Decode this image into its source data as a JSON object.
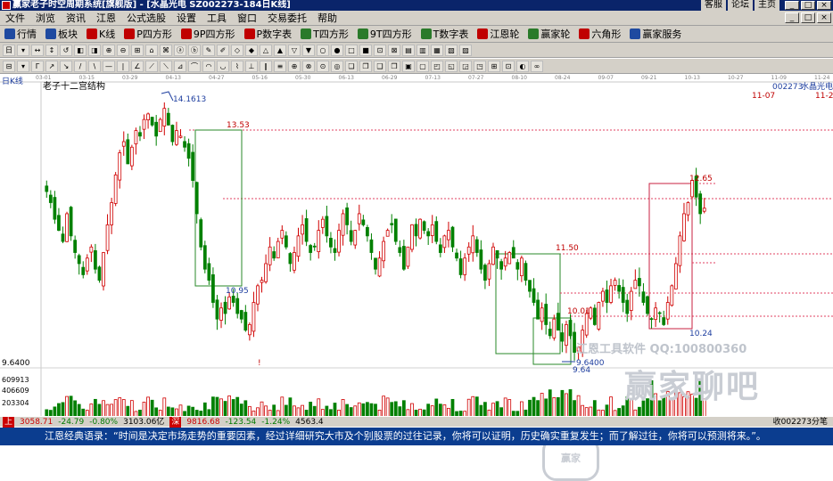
{
  "window": {
    "title": "赢家老子时空周期系统[旗舰版] - [水晶光电  SZ002273-184日K线]",
    "links": [
      "客服",
      "论坛",
      "主页"
    ],
    "controls": [
      "_",
      "□",
      "×"
    ]
  },
  "menubar": {
    "items": [
      "文件",
      "浏览",
      "资讯",
      "江恩",
      "公式选股",
      "设置",
      "工具",
      "窗口",
      "交易委托",
      "帮助"
    ]
  },
  "toolbar1": {
    "items": [
      {
        "icon": "grid-icon",
        "label": "行情",
        "color": "#1f4aa0"
      },
      {
        "icon": "block-icon",
        "label": "板块",
        "color": "#1f4aa0"
      },
      {
        "icon": "kline-icon",
        "label": "K线",
        "color": "#c00000"
      },
      {
        "icon": "p-icon",
        "label": "P四方形",
        "color": "#c00000"
      },
      {
        "icon": "9p-icon",
        "label": "9P四方形",
        "color": "#c00000"
      },
      {
        "icon": "p-table-icon",
        "label": "P数字表",
        "color": "#c00000"
      },
      {
        "icon": "t-icon",
        "label": "T四方形",
        "color": "#2a7a2a"
      },
      {
        "icon": "9t-icon",
        "label": "9T四方形",
        "color": "#2a7a2a"
      },
      {
        "icon": "t-table-icon",
        "label": "T数字表",
        "color": "#2a7a2a"
      },
      {
        "icon": "circle-icon",
        "label": "江恩轮",
        "color": "#c00000"
      },
      {
        "icon": "wheel-icon",
        "label": "赢家轮",
        "color": "#2a7a2a"
      },
      {
        "icon": "hexagon-icon",
        "label": "六角形",
        "color": "#c00000"
      },
      {
        "icon": "service-icon",
        "label": "赢家服务",
        "color": "#1f4aa0"
      }
    ]
  },
  "toolbar2": {
    "glyphs": [
      "日",
      "▾",
      "↔",
      "↕",
      "↺",
      "◧",
      "◨",
      "⊕",
      "⊖",
      "⊞",
      "⌂",
      "⌘",
      "ⓐ",
      "ⓑ",
      "✎",
      "✐",
      "◇",
      "◆",
      "△",
      "▲",
      "▽",
      "▼",
      "○",
      "●",
      "□",
      "■",
      "⊡",
      "⊠",
      "▤",
      "▥",
      "▦",
      "▧",
      "▨"
    ]
  },
  "toolbar3": {
    "glyphs": [
      "⊟",
      "▾",
      "Γ",
      "↗",
      "↘",
      "/",
      "\\",
      "—",
      "|",
      "∠",
      "⟋",
      "⟍",
      "⊿",
      "⌒",
      "◠",
      "◡",
      "⌇",
      "⊥",
      "∥",
      "≡",
      "⊕",
      "⊗",
      "⊙",
      "◎",
      "❏",
      "❐",
      "❑",
      "❒",
      "▣",
      "▢",
      "◰",
      "◱",
      "◲",
      "◳",
      "⊞",
      "⊡",
      "◐",
      "∞"
    ]
  },
  "chart": {
    "period_label": "日K线",
    "subtitle": "老子十二宫结构",
    "stock_code": "002273",
    "stock_name": "水晶光电",
    "date_ticks": [
      "03-01",
      "03-15",
      "03-29",
      "04-13",
      "04-27",
      "05-16",
      "05-30",
      "06-13",
      "06-29",
      "07-13",
      "07-27",
      "08-10",
      "08-24",
      "09-07",
      "09-21",
      "10-13",
      "10-27",
      "11-09",
      "11-24"
    ],
    "future_dates": [
      "11-07",
      "11-2"
    ],
    "price_labels": [
      "14.1613",
      "13.53",
      "10.95",
      "11.50",
      "10.01",
      "10.24",
      "12.65",
      "9.6400",
      "9.64"
    ],
    "left_axis_price": "9.6400",
    "volume_axis": [
      "609913",
      "406609",
      "203304"
    ],
    "watermark_text": "江恩工具软件   QQ:100800360",
    "watermark_big": "赢家聊吧",
    "watermark_logo": "赢家"
  },
  "chart_data": {
    "type": "candlestick",
    "title": "老子十二宫结构",
    "annotations": [
      {
        "label": "14.1613",
        "value": 14.1613
      },
      {
        "label": "13.53",
        "value": 13.53
      },
      {
        "label": "10.95",
        "value": 10.95
      },
      {
        "label": "11.50",
        "value": 11.5
      },
      {
        "label": "10.01",
        "value": 10.01
      },
      {
        "label": "10.24",
        "value": 10.24
      },
      {
        "label": "12.65",
        "value": 12.65
      },
      {
        "label": "9.6400",
        "value": 9.64
      }
    ],
    "closes": [
      12.6,
      12.4,
      12.1,
      11.9,
      11.7,
      12.2,
      11.8,
      11.5,
      11.3,
      11.1,
      11.4,
      11.6,
      11.2,
      11.0,
      11.5,
      12.0,
      12.4,
      12.9,
      13.3,
      13.5,
      13.1,
      13.4,
      13.7,
      13.6,
      13.9,
      14.0,
      13.8,
      13.6,
      13.9,
      14.1,
      13.8,
      13.5,
      13.7,
      13.6,
      13.4,
      13.2,
      12.8,
      12.2,
      11.6,
      11.2,
      11.0,
      10.6,
      10.3,
      10.5,
      10.4,
      10.7,
      10.6,
      10.4,
      10.3,
      10.1,
      10.2,
      10.6,
      10.9,
      11.0,
      11.3,
      11.6,
      11.4,
      11.7,
      11.9,
      11.6,
      11.3,
      11.5,
      11.8,
      12.0,
      11.7,
      11.5,
      11.6,
      11.9,
      12.1,
      11.8,
      11.6,
      11.5,
      11.9,
      12.2,
      12.0,
      11.7,
      11.9,
      12.2,
      12.0,
      11.8,
      11.5,
      11.2,
      11.4,
      11.7,
      11.9,
      12.0,
      11.7,
      11.5,
      11.2,
      11.6,
      12.0,
      11.8,
      12.1,
      11.9,
      11.8,
      12.0,
      11.7,
      11.5,
      11.8,
      11.9,
      11.6,
      11.4,
      11.1,
      11.4,
      11.6,
      11.8,
      11.5,
      11.2,
      11.0,
      11.3,
      11.6,
      11.4,
      11.2,
      11.4,
      11.5,
      11.4,
      11.2,
      11.4,
      11.0,
      10.8,
      10.6,
      10.3,
      10.5,
      10.2,
      10.0,
      10.3,
      10.1,
      9.9,
      10.2,
      10.0,
      9.7,
      9.8,
      10.1,
      10.4,
      10.5,
      10.2,
      10.6,
      10.8,
      10.6,
      10.9,
      11.0,
      10.8,
      10.6,
      10.4,
      10.8,
      11.0,
      10.9,
      10.6,
      10.4,
      10.3,
      10.5,
      10.4,
      10.2,
      10.6,
      10.9,
      11.3,
      11.8,
      12.2,
      12.4,
      12.8,
      12.5,
      12.2,
      12.3
    ]
  },
  "status": {
    "sh_label": "上",
    "sh_index": "3058.71",
    "sh_change": "-24.79",
    "sh_pct": "-0.80%",
    "sh_amount": "3103.06亿",
    "sz_label": "深",
    "sz_index": "9816.68",
    "sz_change": "-123.54",
    "sz_pct": "-1.24%",
    "sz_amount": "4563.4",
    "right_text": "收002273分笔"
  },
  "quote": {
    "text": "江恩经典语录：“时间是决定市场走势的重要因素，经过详细研究大市及个别股票的过往记录，你将可以证明，历史确实重复发生；而了解过往，你将可以预测将来。”。"
  }
}
